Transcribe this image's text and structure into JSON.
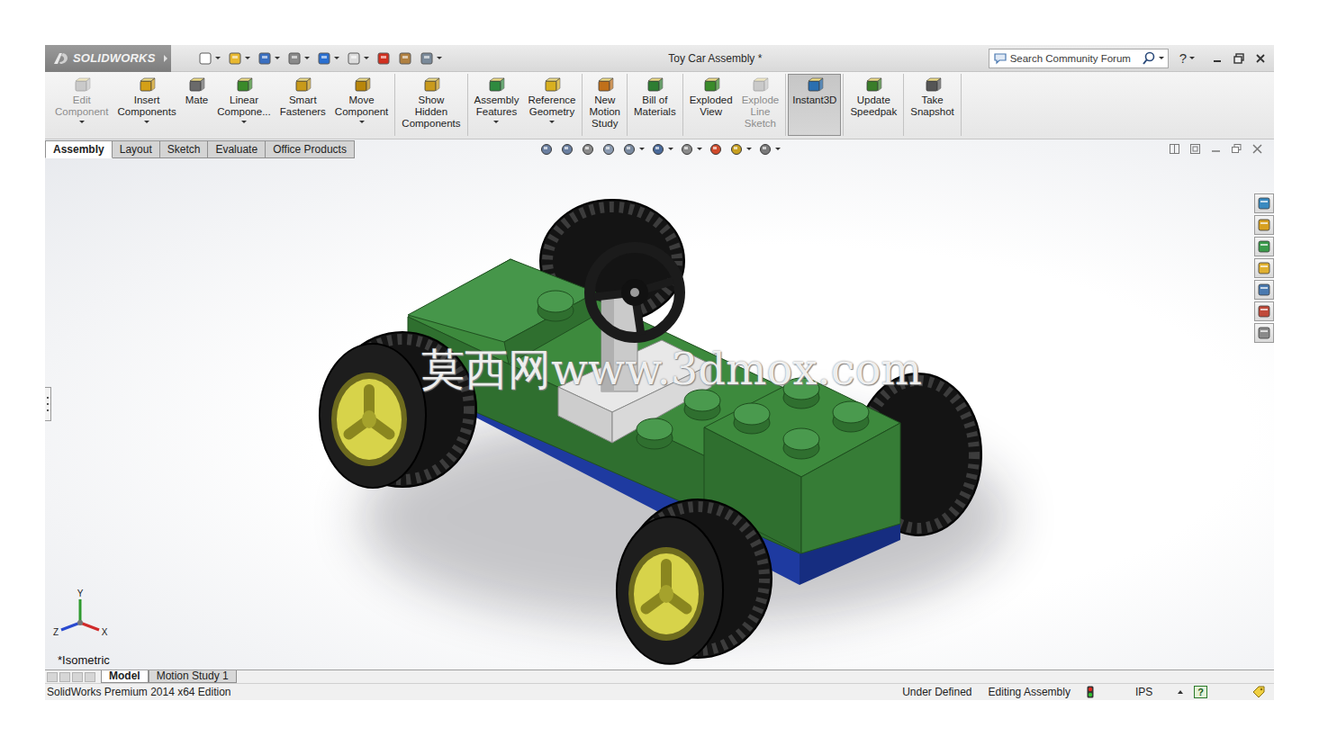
{
  "window": {
    "title": "Toy Car Assembly *",
    "logo": "SOLIDWORKS"
  },
  "search": {
    "placeholder": "Search Community Forum"
  },
  "help": "?",
  "ribbon": {
    "groups": [
      {
        "buttons": [
          {
            "label": [
              "Edit",
              "Component"
            ],
            "disabled": true,
            "dropdown": true,
            "selected": false
          },
          {
            "label": [
              "Insert",
              "Components"
            ],
            "disabled": false,
            "dropdown": true,
            "selected": false
          },
          {
            "label": [
              "Mate"
            ],
            "disabled": false,
            "dropdown": false,
            "selected": false
          },
          {
            "label": [
              "Linear",
              "Compone..."
            ],
            "disabled": false,
            "dropdown": true,
            "selected": false
          },
          {
            "label": [
              "Smart",
              "Fasteners"
            ],
            "disabled": false,
            "dropdown": false,
            "selected": false
          },
          {
            "label": [
              "Move",
              "Component"
            ],
            "disabled": false,
            "dropdown": true,
            "selected": false
          }
        ]
      },
      {
        "buttons": [
          {
            "label": [
              "Show",
              "Hidden",
              "Components"
            ],
            "disabled": false,
            "dropdown": false,
            "selected": false
          }
        ]
      },
      {
        "buttons": [
          {
            "label": [
              "Assembly",
              "Features"
            ],
            "disabled": false,
            "dropdown": true,
            "selected": false
          },
          {
            "label": [
              "Reference",
              "Geometry"
            ],
            "disabled": false,
            "dropdown": true,
            "selected": false
          }
        ]
      },
      {
        "buttons": [
          {
            "label": [
              "New",
              "Motion",
              "Study"
            ],
            "disabled": false,
            "dropdown": false,
            "selected": false
          }
        ]
      },
      {
        "buttons": [
          {
            "label": [
              "Bill of",
              "Materials"
            ],
            "disabled": false,
            "dropdown": false,
            "selected": false
          }
        ]
      },
      {
        "buttons": [
          {
            "label": [
              "Exploded",
              "View"
            ],
            "disabled": false,
            "dropdown": false,
            "selected": false
          },
          {
            "label": [
              "Explode",
              "Line",
              "Sketch"
            ],
            "disabled": true,
            "dropdown": false,
            "selected": false
          }
        ]
      },
      {
        "buttons": [
          {
            "label": [
              "Instant3D"
            ],
            "disabled": false,
            "dropdown": false,
            "selected": true
          }
        ]
      },
      {
        "buttons": [
          {
            "label": [
              "Update",
              "Speedpak"
            ],
            "disabled": false,
            "dropdown": false,
            "selected": false
          }
        ]
      },
      {
        "buttons": [
          {
            "label": [
              "Take",
              "Snapshot"
            ],
            "disabled": false,
            "dropdown": false,
            "selected": false
          }
        ]
      }
    ]
  },
  "command_tabs": [
    {
      "label": "Assembly",
      "selected": true
    },
    {
      "label": "Layout",
      "selected": false
    },
    {
      "label": "Sketch",
      "selected": false
    },
    {
      "label": "Evaluate",
      "selected": false
    },
    {
      "label": "Office Products",
      "selected": false
    }
  ],
  "viewport": {
    "orientation": "*Isometric",
    "triad": {
      "x": "X",
      "y": "Y",
      "z": "Z"
    },
    "watermark": "莫西网www.3dmox.com"
  },
  "model_tabs": [
    {
      "label": "Model",
      "selected": true
    },
    {
      "label": "Motion Study 1",
      "selected": false
    }
  ],
  "status_bar": {
    "edition": "SolidWorks Premium 2014 x64 Edition",
    "state": "Under Defined",
    "mode": "Editing Assembly",
    "units": "IPS",
    "help": "?"
  }
}
